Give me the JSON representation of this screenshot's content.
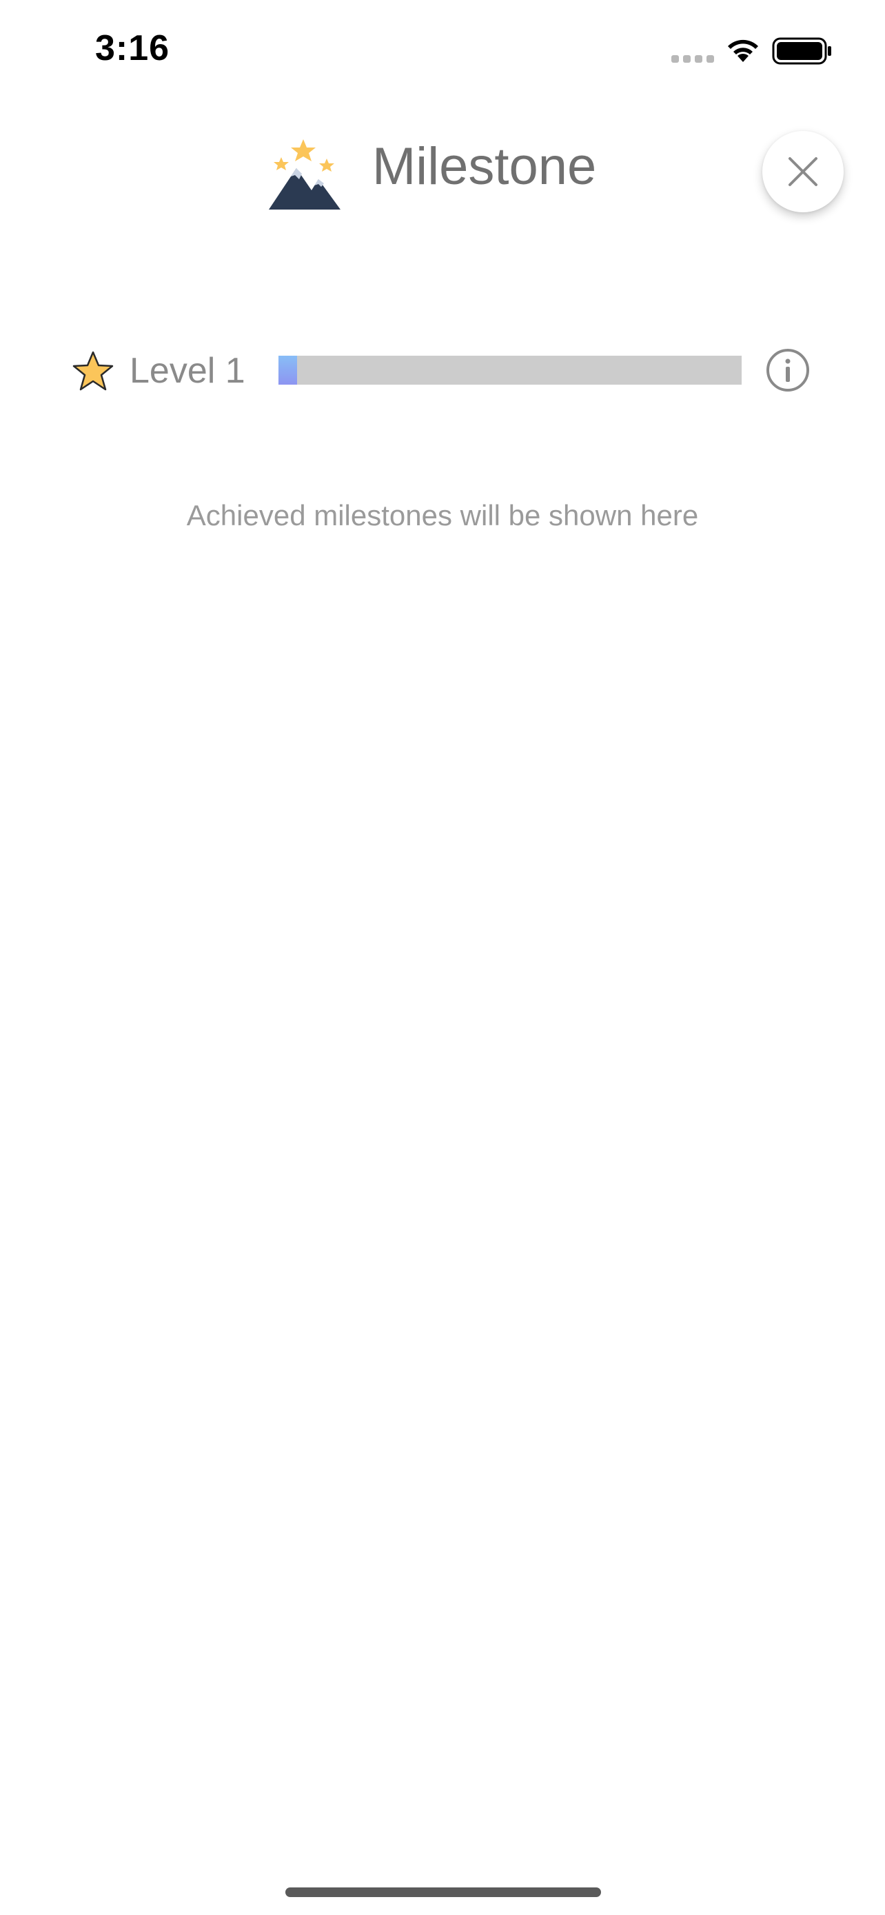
{
  "status_bar": {
    "time": "3:16",
    "icons": [
      "signal-dots-icon",
      "wifi-icon",
      "battery-icon"
    ]
  },
  "header": {
    "title": "Milestone",
    "logo_icon": "mountain-stars-icon",
    "close_icon": "close-icon"
  },
  "level": {
    "label": "Level 1",
    "star_icon": "star-icon",
    "progress": 0.04,
    "info_icon": "info-icon"
  },
  "empty_state": {
    "message": "Achieved milestones will be shown here"
  },
  "colors": {
    "title_text": "#707070",
    "progress_track": "#cccccc",
    "progress_fill_start": "#88bdf6",
    "progress_fill_end": "#8d95f1",
    "star_fill": "#fbc55a",
    "mountain": "#2b3a52"
  }
}
